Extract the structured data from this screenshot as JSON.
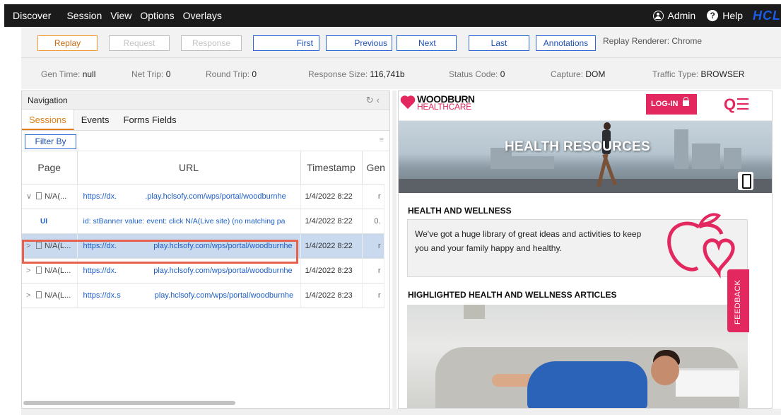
{
  "menu": {
    "items": [
      "Discover",
      "Session",
      "View",
      "Options",
      "Overlays"
    ],
    "admin": "Admin",
    "help": "Help",
    "brand": "HCL"
  },
  "toolbar": {
    "replay": "Replay",
    "request": "Request",
    "response": "Response",
    "first": "First",
    "previous": "Previous",
    "next": "Next",
    "last": "Last",
    "annotations": "Annotations",
    "renderer": "Replay Renderer: Chrome"
  },
  "info": {
    "gen_time_label": "Gen Time:",
    "gen_time": "null",
    "net_trip_label": "Net Trip:",
    "net_trip": "0",
    "round_trip_label": "Round Trip:",
    "round_trip": "0",
    "response_size_label": "Response Size:",
    "response_size": "116,741b",
    "status_code_label": "Status Code:",
    "status_code": "0",
    "capture_label": "Capture:",
    "capture": "DOM",
    "traffic_type_label": "Traffic Type:",
    "traffic_type": "BROWSER"
  },
  "navigation": {
    "title": "Navigation",
    "tabs": [
      "Sessions",
      "Events",
      "Forms Fields"
    ],
    "filter": "Filter By",
    "columns": [
      "Page",
      "URL",
      "Timestamp",
      "Gen"
    ],
    "rows": [
      {
        "chevron": "∨",
        "page": "N/A(...",
        "url_a": "https://dx.",
        "url_b": ".play.hclsofy.com/wps/portal/woodburnhe",
        "timestamp": "1/4/2022 8:22",
        "gen": "r"
      },
      {
        "chevron": "",
        "page": "UI",
        "url_a": "id: stBanner value: event: click N/A(Live site) (no matching pa",
        "url_b": "",
        "timestamp": "1/4/2022 8:22",
        "gen": "0."
      },
      {
        "chevron": ">",
        "page": "N/A(L...",
        "url_a": "https://dx.",
        "url_b": "play.hclsofy.com/wps/portal/woodburnhe",
        "timestamp": "1/4/2022 8:22",
        "gen": "r"
      },
      {
        "chevron": ">",
        "page": "N/A(L...",
        "url_a": "https://dx.",
        "url_b": "play.hclsofy.com/wps/portal/woodburnhe",
        "timestamp": "1/4/2022 8:23",
        "gen": "r"
      },
      {
        "chevron": ">",
        "page": "N/A(L...",
        "url_a": "https://dx.s",
        "url_b": "play.hclsofy.com/wps/portal/woodburnhe",
        "timestamp": "1/4/2022 8:23",
        "gen": "r"
      }
    ]
  },
  "preview": {
    "logo_line1": "WOODBURN",
    "logo_line2": "HEALTHCARE",
    "login": "LOG-IN",
    "banner_title": "HEALTH RESOURCES",
    "section1_title": "HEALTH AND WELLNESS",
    "section1_text": "We've got a huge library of great ideas and activities to keep you and your family happy and healthy.",
    "section2_title": "HIGHLIGHTED HEALTH AND WELLNESS ARTICLES",
    "feedback": "FEEDBACK"
  },
  "colors": {
    "accent": "#e2285e",
    "link": "#1e5fc8",
    "orange": "#e07d15",
    "selected_row": "#c9d9ee"
  }
}
